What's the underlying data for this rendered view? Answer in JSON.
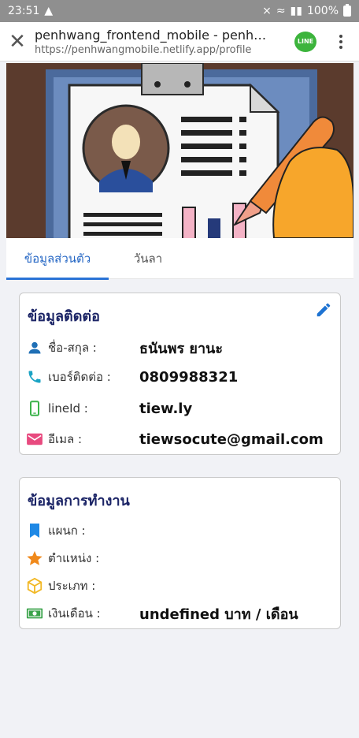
{
  "status_bar": {
    "time": "23:51",
    "battery": "100%"
  },
  "browser": {
    "title": "penhwang_frontend_mobile - penhwang",
    "url": "https://penhwangmobile.netlify.app/profile",
    "line_badge": "LINE"
  },
  "tabs": [
    {
      "label": "ข้อมูลส่วนตัว",
      "active": true
    },
    {
      "label": "วันลา",
      "active": false
    }
  ],
  "contact": {
    "title": "ข้อมูลติดต่อ",
    "rows": [
      {
        "icon": "person-icon",
        "label": "ชื่อ-สกุล :",
        "value": "ธนันพร ยานะ"
      },
      {
        "icon": "phone-icon",
        "label": "เบอร์ติดต่อ :",
        "value": "0809988321"
      },
      {
        "icon": "mobile-icon",
        "label": "lineId :",
        "value": "tiew.ly"
      },
      {
        "icon": "mail-icon",
        "label": "อีเมล :",
        "value": "tiewsocute@gmail.com"
      }
    ]
  },
  "work": {
    "title": "ข้อมูลการทำงาน",
    "rows": [
      {
        "icon": "bookmark-icon",
        "label": "แผนก :",
        "value": ""
      },
      {
        "icon": "star-icon",
        "label": "ตำแหน่ง :",
        "value": ""
      },
      {
        "icon": "cube-icon",
        "label": "ประเภท :",
        "value": ""
      },
      {
        "icon": "money-icon",
        "label": "เงินเดือน :",
        "value": "undefined บาท / เดือน"
      }
    ]
  },
  "colors": {
    "accent": "#2466c4",
    "card_title": "#1b2466",
    "person_icon": "#1f6fb5",
    "phone_icon": "#1aa3c4",
    "mobile_icon": "#3bb24a",
    "mail_icon": "#e84a7f",
    "bookmark_icon": "#1e88e5",
    "star_icon": "#f0891b",
    "cube_icon": "#f2b825",
    "money_icon": "#3aa34a"
  }
}
